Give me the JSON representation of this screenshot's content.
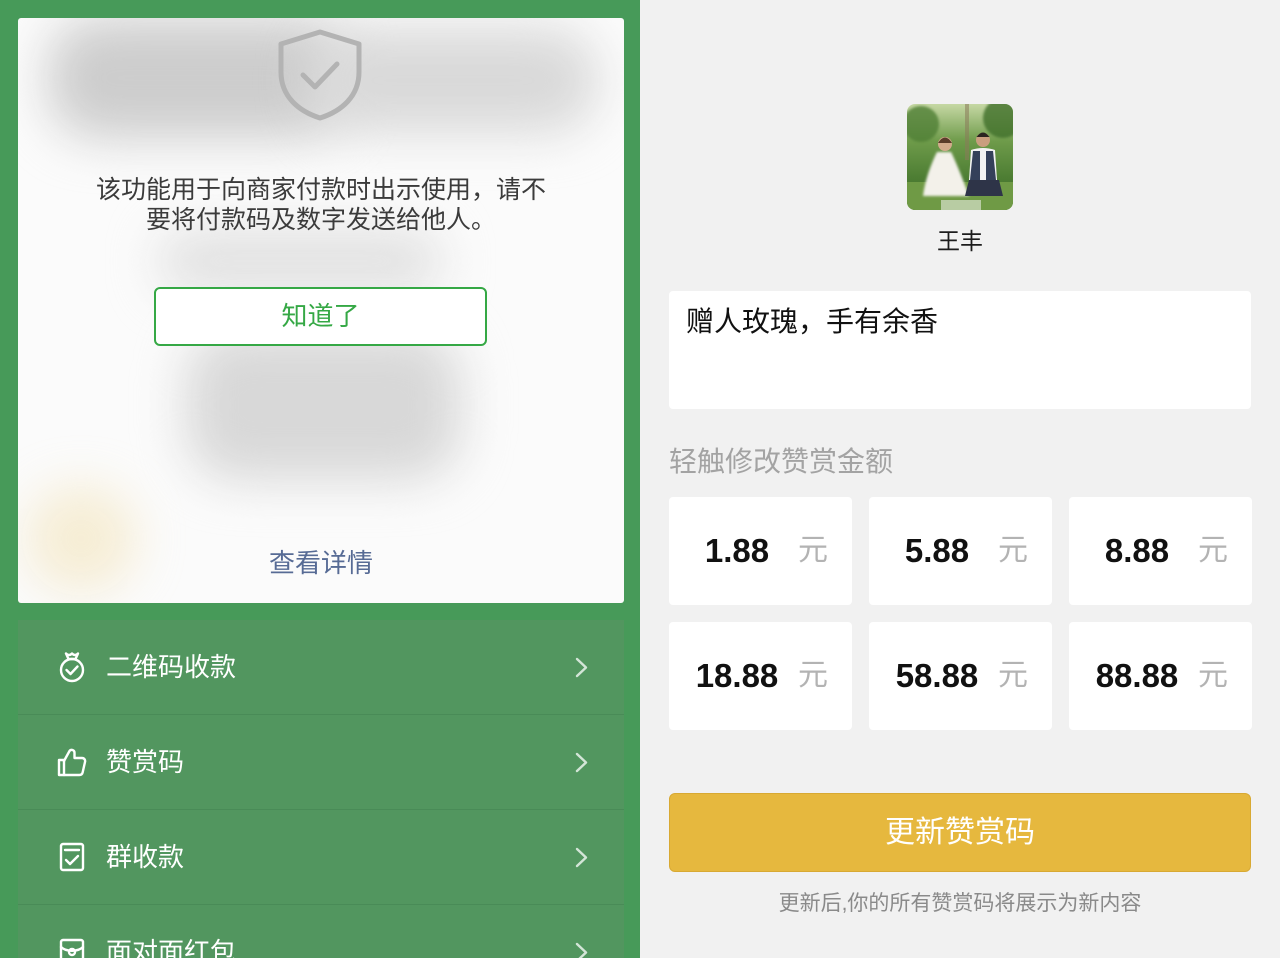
{
  "colors": {
    "frame_green": "#479a59",
    "menu_green": "#52965f",
    "confirm_green": "#35a845",
    "link_blue": "#576b95",
    "button_yellow": "#e6b83e",
    "panel_gray": "#f1f1f1"
  },
  "pay_screen": {
    "notice": {
      "icon": "shield-check-icon",
      "lines": [
        "该功能用于向商家付款时出示使用，请不",
        "要将付款码及数字发送给他人。"
      ],
      "confirm_label": "知道了",
      "details_link": "查看详情"
    },
    "menu": [
      {
        "icon": "money-bag-check-icon",
        "label": "二维码收款"
      },
      {
        "icon": "thumbs-up-icon",
        "label": "赞赏码"
      },
      {
        "icon": "receipt-check-icon",
        "label": "群收款"
      },
      {
        "icon": "red-packet-icon",
        "label": "面对面红包"
      }
    ]
  },
  "reward_screen": {
    "avatar_icon": "avatar-photo",
    "profile_name": "王丰",
    "message": "赠人玫瑰，手有余香",
    "amount_hint": "轻触修改赞赏金额",
    "currency_unit": "元",
    "amounts": [
      "1.88",
      "5.88",
      "8.88",
      "18.88",
      "58.88",
      "88.88"
    ],
    "update_button": "更新赞赏码",
    "footnote": "更新后,你的所有赞赏码将展示为新内容"
  }
}
